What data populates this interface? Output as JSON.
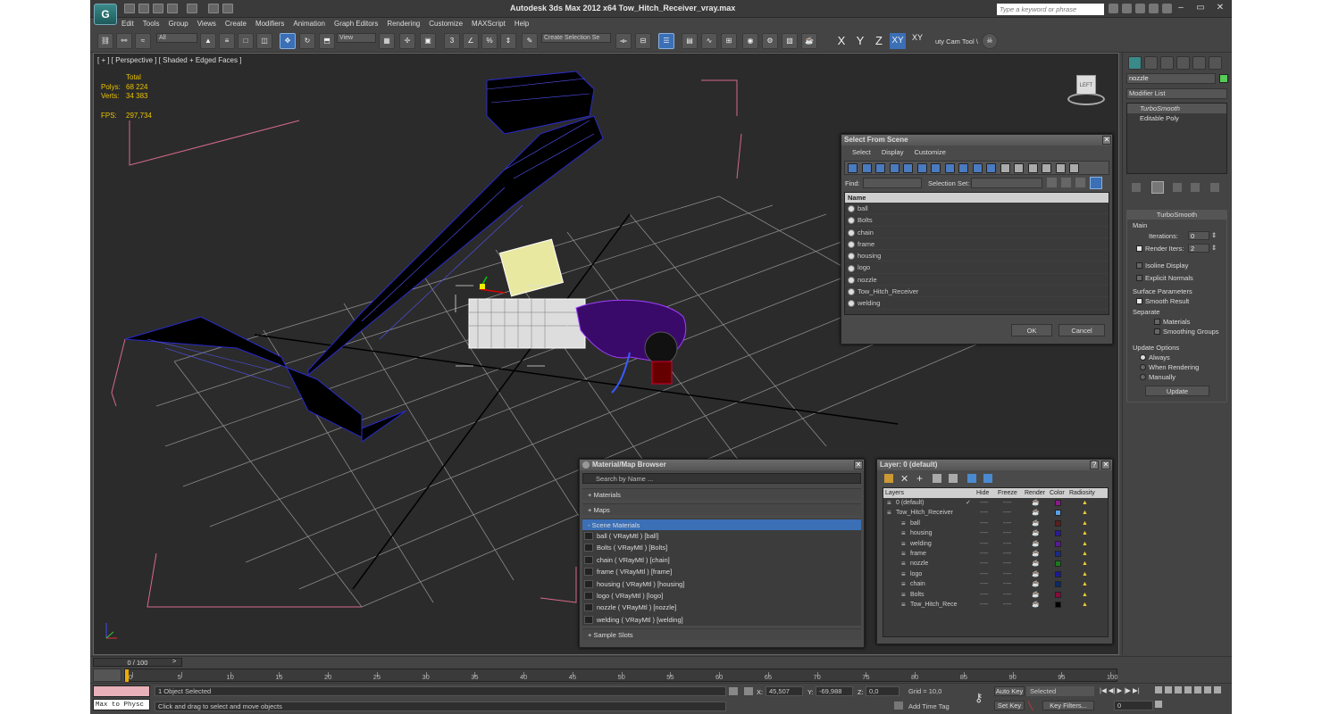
{
  "window": {
    "title": "Autodesk 3ds Max  2012 x64      Tow_Hitch_Receiver_vray.max",
    "search_placeholder": "Type a keyword or phrase",
    "app_logo": "G"
  },
  "menu": [
    "Edit",
    "Tools",
    "Group",
    "Views",
    "Create",
    "Modifiers",
    "Animation",
    "Graph Editors",
    "Rendering",
    "Customize",
    "MAXScript",
    "Help"
  ],
  "toolbar": {
    "selection_filter": "All",
    "ref_coord": "View",
    "selection_set_placeholder": "Create Selection Se",
    "axis_x": "X",
    "axis_y": "Y",
    "axis_z": "Z",
    "axis_xy": "XY",
    "axis_xy2": "XY",
    "cam_tool": "uty Cam Tool \\"
  },
  "viewport": {
    "label": "[ + ] [ Perspective ] [ Shaded + Edged Faces ]",
    "stats": {
      "header": "Total",
      "polys_label": "Polys:",
      "polys": "68 224",
      "verts_label": "Verts:",
      "verts": "34 383",
      "fps_label": "FPS:",
      "fps": "297,734"
    },
    "viewcube_label": "LEFT"
  },
  "command_panel": {
    "object_name": "nozzle",
    "modifier_list": "Modifier List",
    "stack": [
      "TurboSmooth",
      "Editable Poly"
    ],
    "rollout_title": "TurboSmooth",
    "main": "Main",
    "iterations_label": "Iterations:",
    "iterations": "0",
    "render_iters_label": "Render Iters:",
    "render_iters": "2",
    "isoline": "Isoline Display",
    "explicit": "Explicit Normals",
    "surface_params": "Surface Parameters",
    "smooth_result": "Smooth Result",
    "separate": "Separate",
    "materials": "Materials",
    "smoothing_groups": "Smoothing Groups",
    "update_options": "Update Options",
    "always": "Always",
    "when_rendering": "When Rendering",
    "manually": "Manually",
    "update_btn": "Update"
  },
  "select_from_scene": {
    "title": "Select From Scene",
    "menus": [
      "Select",
      "Display",
      "Customize"
    ],
    "find_label": "Find:",
    "selset_label": "Selection Set:",
    "col_name": "Name",
    "items": [
      "ball",
      "Bolts",
      "chain",
      "frame",
      "housing",
      "logo",
      "nozzle",
      "Tow_Hitch_Receiver",
      "welding"
    ],
    "ok": "OK",
    "cancel": "Cancel"
  },
  "material_browser": {
    "title": "Material/Map Browser",
    "search_placeholder": "Search by Name ...",
    "cat_materials": "+ Materials",
    "cat_maps": "+ Maps",
    "cat_scene": "- Scene Materials",
    "scene_materials": [
      "ball  ( VRayMtl ) [ball]",
      "Bolts  ( VRayMtl ) [Bolts]",
      "chain  ( VRayMtl ) [chain]",
      "frame  ( VRayMtl ) [frame]",
      "housing  ( VRayMtl ) [housing]",
      "logo  ( VRayMtl ) [logo]",
      "nozzle  ( VRayMtl ) [nozzle]",
      "welding  ( VRayMtl ) [welding]"
    ],
    "cat_sample": "+ Sample Slots"
  },
  "layer_dialog": {
    "title": "Layer: 0 (default)",
    "help": "?",
    "columns": [
      "Layers",
      "Hide",
      "Freeze",
      "Render",
      "Color",
      "Radiosity"
    ],
    "rows": [
      {
        "name": "0 (default)",
        "indent": 0,
        "color": "#8a1a8a",
        "check": "✓"
      },
      {
        "name": "Tow_Hitch_Receiver",
        "indent": 0,
        "color": "#5aa0e6",
        "check": ""
      },
      {
        "name": "ball",
        "indent": 1,
        "color": "#5c1e1e",
        "check": ""
      },
      {
        "name": "housing",
        "indent": 1,
        "color": "#2a1a9a",
        "check": ""
      },
      {
        "name": "welding",
        "indent": 1,
        "color": "#5a1a9a",
        "check": ""
      },
      {
        "name": "frame",
        "indent": 1,
        "color": "#1a2a8a",
        "check": ""
      },
      {
        "name": "nozzle",
        "indent": 1,
        "color": "#1a7a1a",
        "check": ""
      },
      {
        "name": "logo",
        "indent": 1,
        "color": "#1a1a9a",
        "check": ""
      },
      {
        "name": "chain",
        "indent": 1,
        "color": "#0a2a6a",
        "check": ""
      },
      {
        "name": "Bolts",
        "indent": 1,
        "color": "#8a0a3a",
        "check": ""
      },
      {
        "name": "Tow_Hitch_Rece",
        "indent": 1,
        "color": "#000000",
        "check": ""
      }
    ]
  },
  "timeline": {
    "frame": "0 / 100",
    "ticks": [
      "0",
      "5",
      "10",
      "15",
      "20",
      "25",
      "30",
      "35",
      "40",
      "45",
      "50",
      "55",
      "60",
      "65",
      "70",
      "75",
      "80",
      "85",
      "90",
      "95",
      "100"
    ]
  },
  "status": {
    "maxscript": "Max to Physc",
    "selected": "1 Object Selected",
    "prompt": "Click and drag to select and move objects",
    "x_label": "X:",
    "x": "45,507",
    "y_label": "Y:",
    "y": "-69,988",
    "z_label": "Z:",
    "z": "0,0",
    "grid": "Grid = 10,0",
    "add_time_tag": "Add Time Tag",
    "auto_key": "Auto Key",
    "set_key": "Set Key",
    "selected_dd": "Selected",
    "key_filters": "Key Filters...",
    "frame_field": "0"
  }
}
